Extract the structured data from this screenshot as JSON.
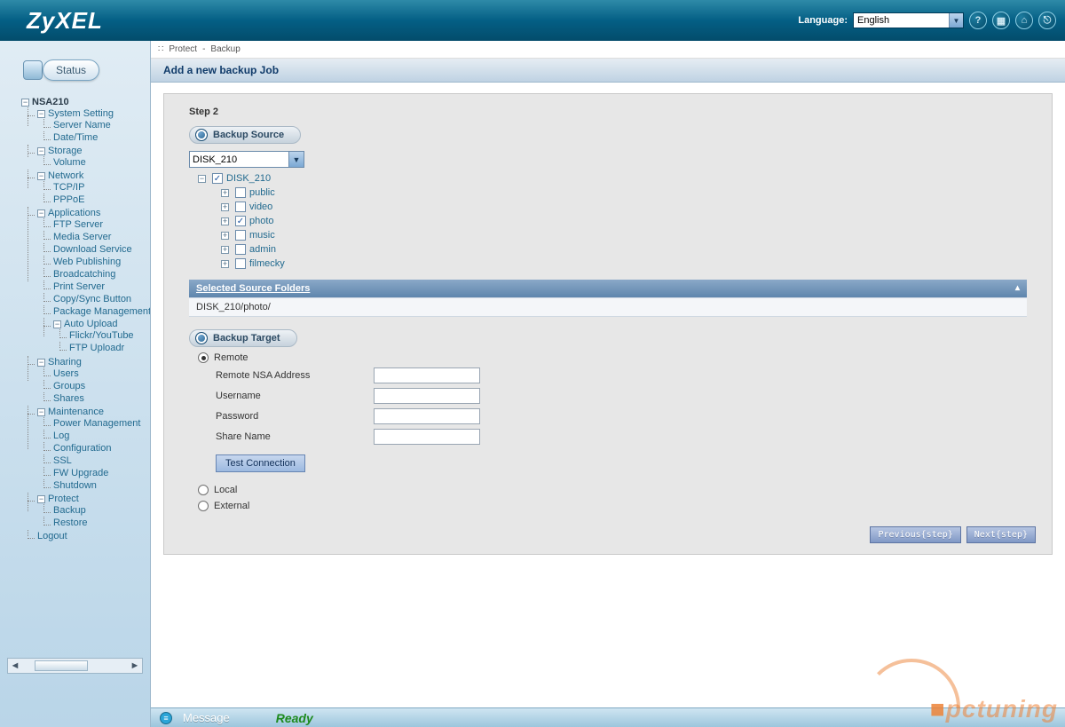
{
  "header": {
    "brand": "ZyXEL",
    "language_label": "Language:",
    "language_value": "English",
    "icons": [
      "help-icon",
      "grid-icon",
      "home-icon",
      "logout-icon"
    ]
  },
  "sidebar": {
    "status_label": "Status",
    "root": "NSA210",
    "system_setting": {
      "label": "System Setting",
      "children": [
        "Server Name",
        "Date/Time"
      ]
    },
    "storage": {
      "label": "Storage",
      "children": [
        "Volume"
      ]
    },
    "network": {
      "label": "Network",
      "children": [
        "TCP/IP",
        "PPPoE"
      ]
    },
    "applications": {
      "label": "Applications",
      "children": [
        "FTP Server",
        "Media Server",
        "Download Service",
        "Web Publishing",
        "Broadcatching",
        "Print Server",
        "Copy/Sync Button",
        "Package Management"
      ],
      "auto_upload": {
        "label": "Auto Upload",
        "children": [
          "Flickr/YouTube",
          "FTP Uploadr"
        ]
      }
    },
    "sharing": {
      "label": "Sharing",
      "children": [
        "Users",
        "Groups",
        "Shares"
      ]
    },
    "maintenance": {
      "label": "Maintenance",
      "children": [
        "Power Management",
        "Log",
        "Configuration",
        "SSL",
        "FW Upgrade",
        "Shutdown"
      ]
    },
    "protect": {
      "label": "Protect",
      "children": [
        "Backup",
        "Restore"
      ]
    },
    "logout": "Logout"
  },
  "breadcrumb": {
    "a": "Protect",
    "b": "Backup"
  },
  "page": {
    "title": "Add a new backup Job",
    "step": "Step 2",
    "backup_source_label": "Backup Source",
    "source_select": "DISK_210",
    "tree_root": "DISK_210",
    "tree_items": [
      {
        "label": "public",
        "checked": false
      },
      {
        "label": "video",
        "checked": false
      },
      {
        "label": "photo",
        "checked": true
      },
      {
        "label": "music",
        "checked": false
      },
      {
        "label": "admin",
        "checked": false
      },
      {
        "label": "filmecky",
        "checked": false
      }
    ],
    "selected_header": "Selected Source Folders",
    "selected_path": "DISK_210/photo/",
    "backup_target_label": "Backup Target",
    "target_options": {
      "remote": "Remote",
      "local": "Local",
      "external": "External"
    },
    "target_selected": "remote",
    "remote_fields": {
      "address": "Remote NSA Address",
      "username": "Username",
      "password": "Password",
      "share": "Share Name"
    },
    "test_btn": "Test Connection",
    "prev_btn": "Previous{step}",
    "next_btn": "Next{step}"
  },
  "footer": {
    "message_label": "Message",
    "ready": "Ready"
  },
  "watermark": "pctuning"
}
